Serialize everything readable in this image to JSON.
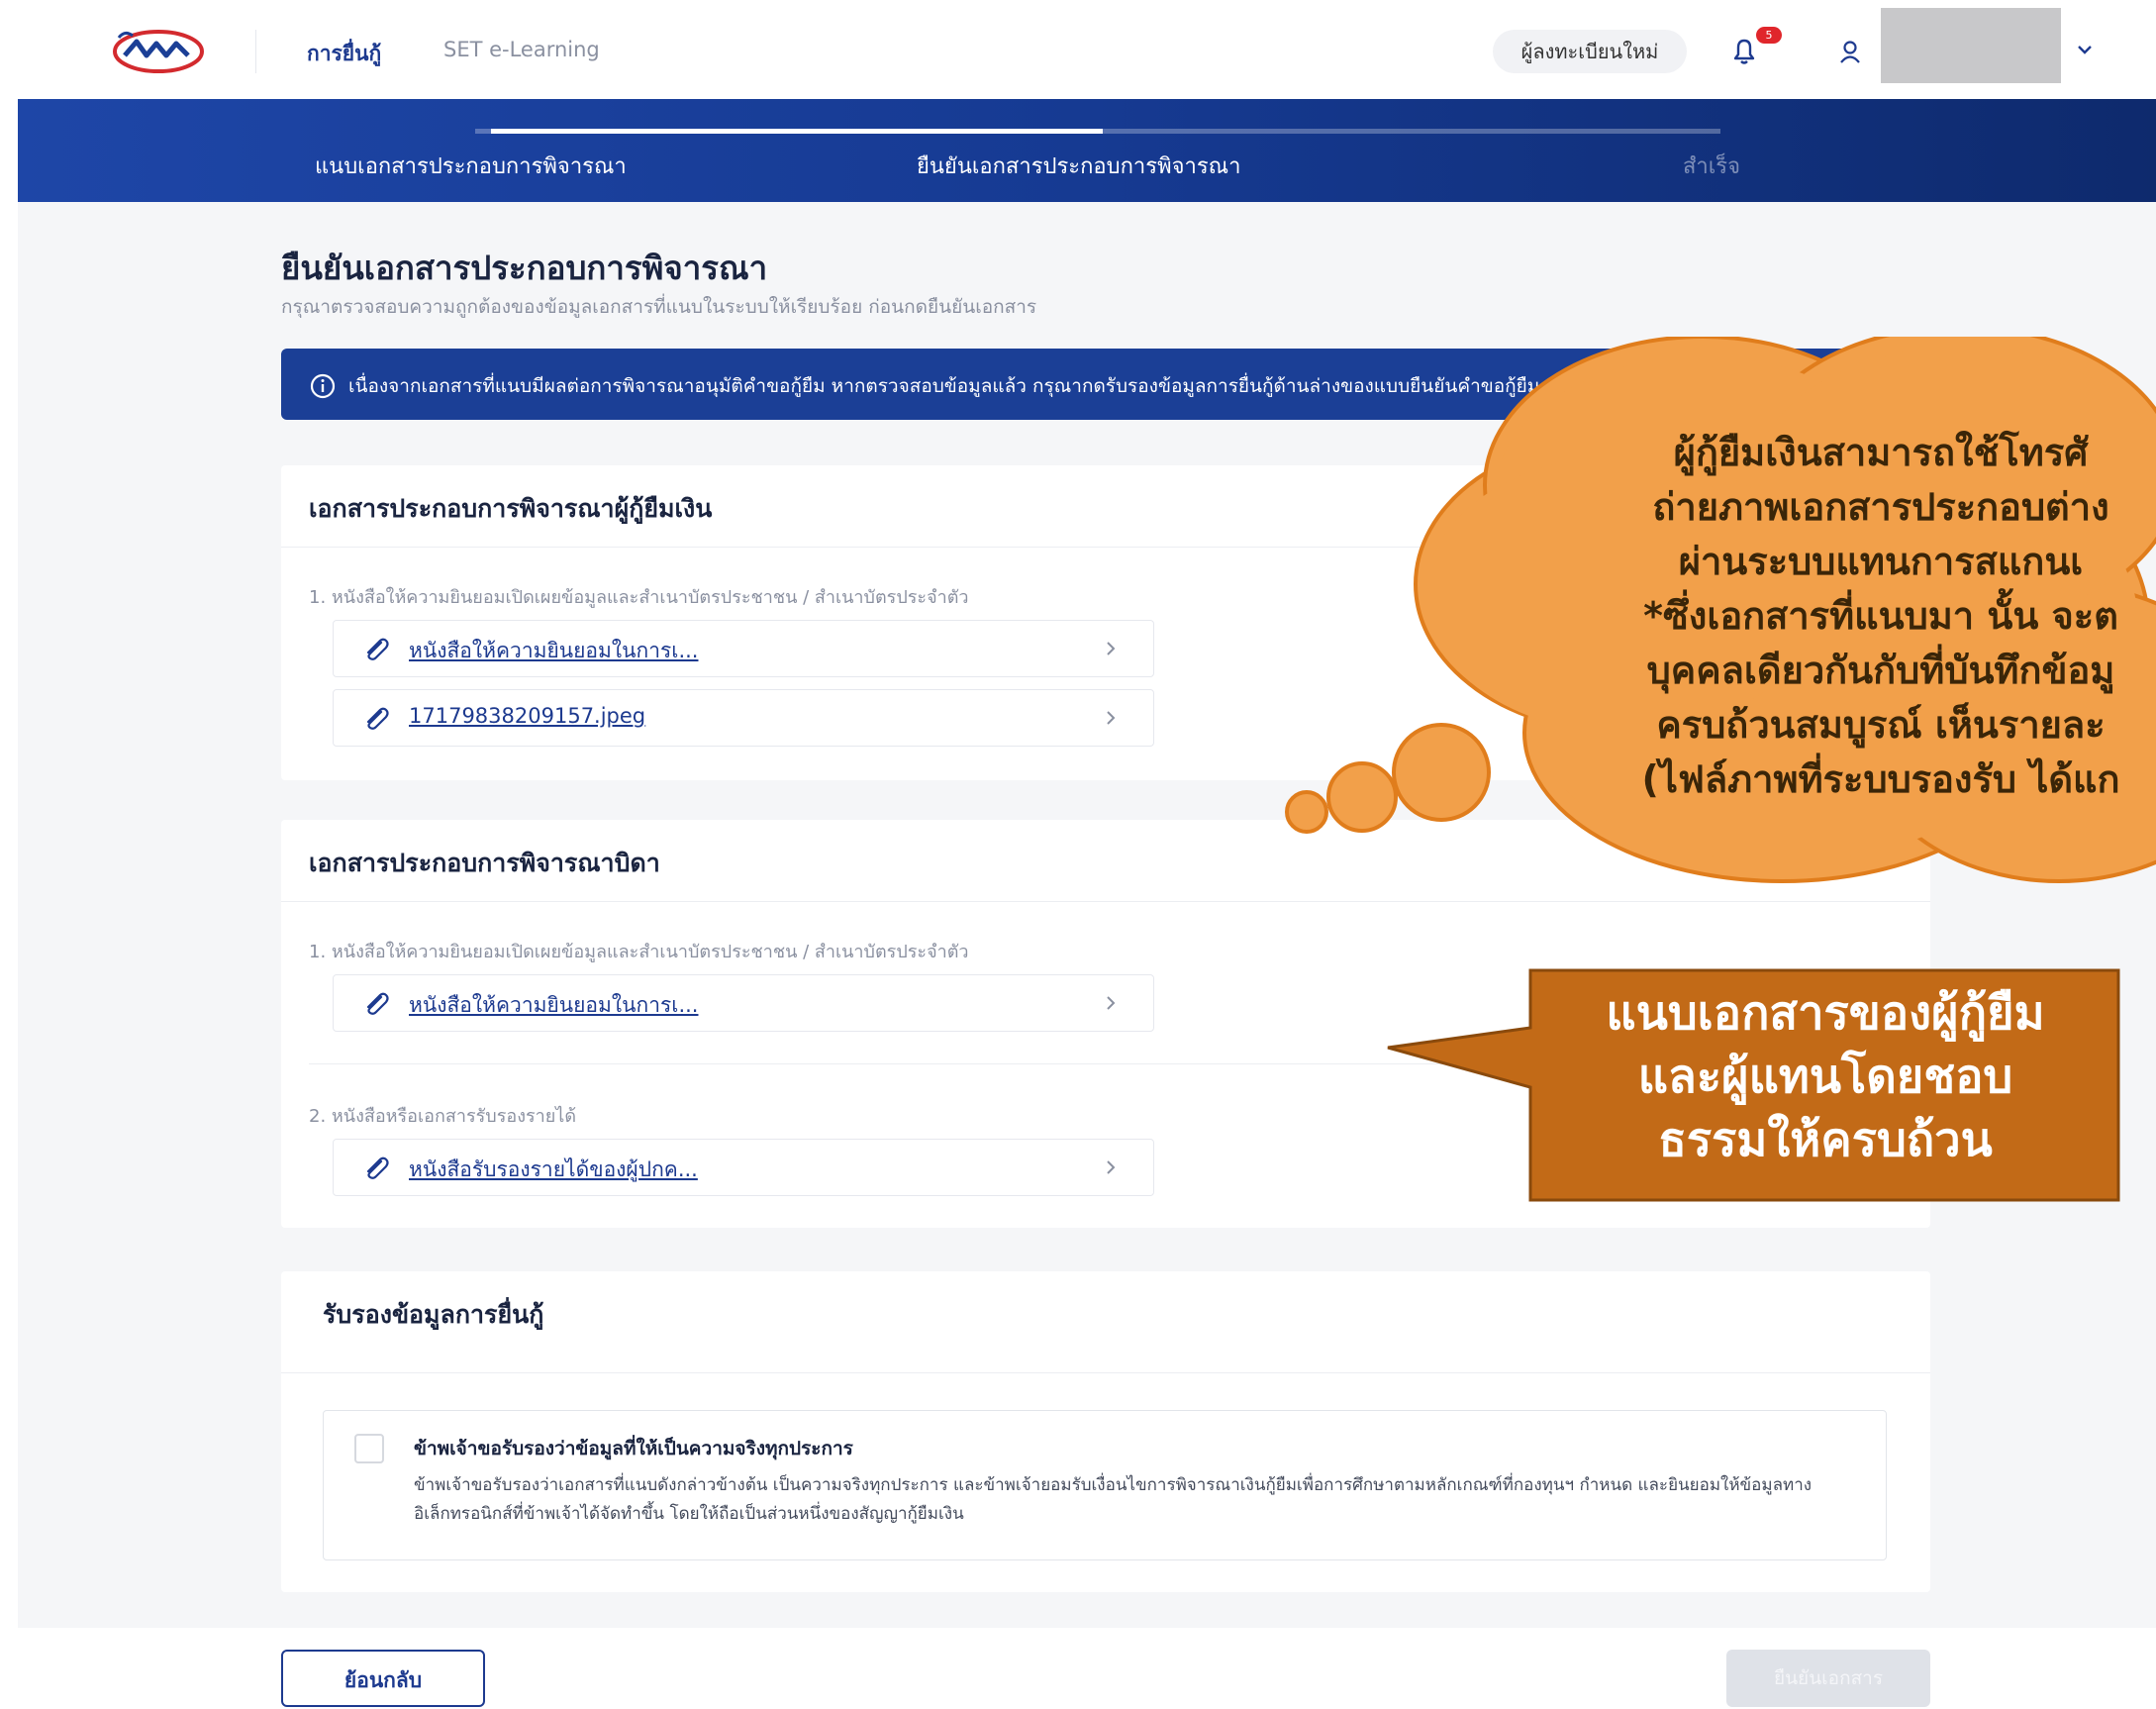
{
  "nav": {
    "active_link": "การยื่นกู้",
    "second_link": "SET e-Learning",
    "register_label": "ผู้ลงทะเบียนใหม่",
    "notification_count": "5"
  },
  "stepper": {
    "steps": [
      {
        "label": "แนบเอกสารประกอบการพิจารณา"
      },
      {
        "label": "ยืนยันเอกสารประกอบการพิจารณา"
      },
      {
        "label": "สำเร็จ"
      }
    ]
  },
  "page": {
    "title": "ยืนยันเอกสารประกอบการพิจารณา",
    "subtitle": "กรุณาตรวจสอบความถูกต้องของข้อมูลเอกสารที่แนบในระบบให้เรียบร้อย ก่อนกดยืนยันเอกสาร",
    "info_banner": "เนื่องจากเอกสารที่แนบมีผลต่อการพิจารณาอนุมัติคำขอกู้ยืม หากตรวจสอบข้อมูลแล้ว กรุณากดรับรองข้อมูลการยื่นกู้ด้านล่างของแบบยืนยันคำขอกู้ยืม"
  },
  "borrower_section": {
    "heading": "เอกสารประกอบการพิจารณาผู้กู้ยืมเงิน",
    "doc_label": "1. หนังสือให้ความยินยอมเปิดเผยข้อมูลและสำเนาบัตรประชาชน / สำเนาบัตรประจำตัว",
    "files": [
      "หนังสือให้ความยินยอมในการเ...",
      "17179838209157.jpeg"
    ]
  },
  "father_section": {
    "heading": "เอกสารประกอบการพิจารณาบิดา",
    "doc1_label": "1. หนังสือให้ความยินยอมเปิดเผยข้อมูลและสำเนาบัตรประชาชน / สำเนาบัตรประจำตัว",
    "doc1_file": "หนังสือให้ความยินยอมในการเ...",
    "doc2_label": "2. หนังสือหรือเอกสารรับรองรายได้",
    "doc2_file": "หนังสือรับรองรายได้ของผู้ปกค..."
  },
  "consent": {
    "heading": "รับรองข้อมูลการยื่นกู้",
    "title": "ข้าพเจ้าขอรับรองว่าข้อมูลที่ให้เป็นความจริงทุกประการ",
    "body": "ข้าพเจ้าขอรับรองว่าเอกสารที่แนบดังกล่าวข้างต้น เป็นความจริงทุกประการ และข้าพเจ้ายอมรับเงื่อนไขการพิจารณาเงินกู้ยืมเพื่อการศึกษาตามหลักเกณฑ์ที่กองทุนฯ กำหนด และยินยอมให้ข้อมูลทางอิเล็กทรอนิกส์ที่ข้าพเจ้าได้จัดทำขึ้น โดยให้ถือเป็นส่วนหนึ่งของสัญญากู้ยืมเงิน",
    "checked": false
  },
  "footer": {
    "back_label": "ย้อนกลับ",
    "confirm_label": "ยืนยันเอกสาร"
  },
  "overlays": {
    "cloud_lines": [
      "ผู้กู้ยืมเงินสามารถใช้โทรศั",
      "ถ่ายภาพเอกสารประกอบต่าง",
      "ผ่านระบบแทนการสแกนเ",
      "*ซึ่งเอกสารที่แนบมา นั้น จะต",
      "บุคคลเดียวกันกับที่บันทึกข้อมู",
      "ครบถ้วนสมบูรณ์ เห็นรายละ",
      "(ไฟล์ภาพที่ระบบรองรับ ได้แก"
    ],
    "callout_lines": [
      "แนบเอกสารของผู้กู้ยืม",
      "และผู้แทนโดยชอบ",
      "ธรรมให้ครบถ้วน"
    ],
    "cloud_color": "#f2a04a",
    "callout_color": "#c26a17"
  },
  "colors": {
    "brand_navy": "#1b3f96",
    "link_blue": "#1d3a8f",
    "badge_red": "#e0262b"
  }
}
